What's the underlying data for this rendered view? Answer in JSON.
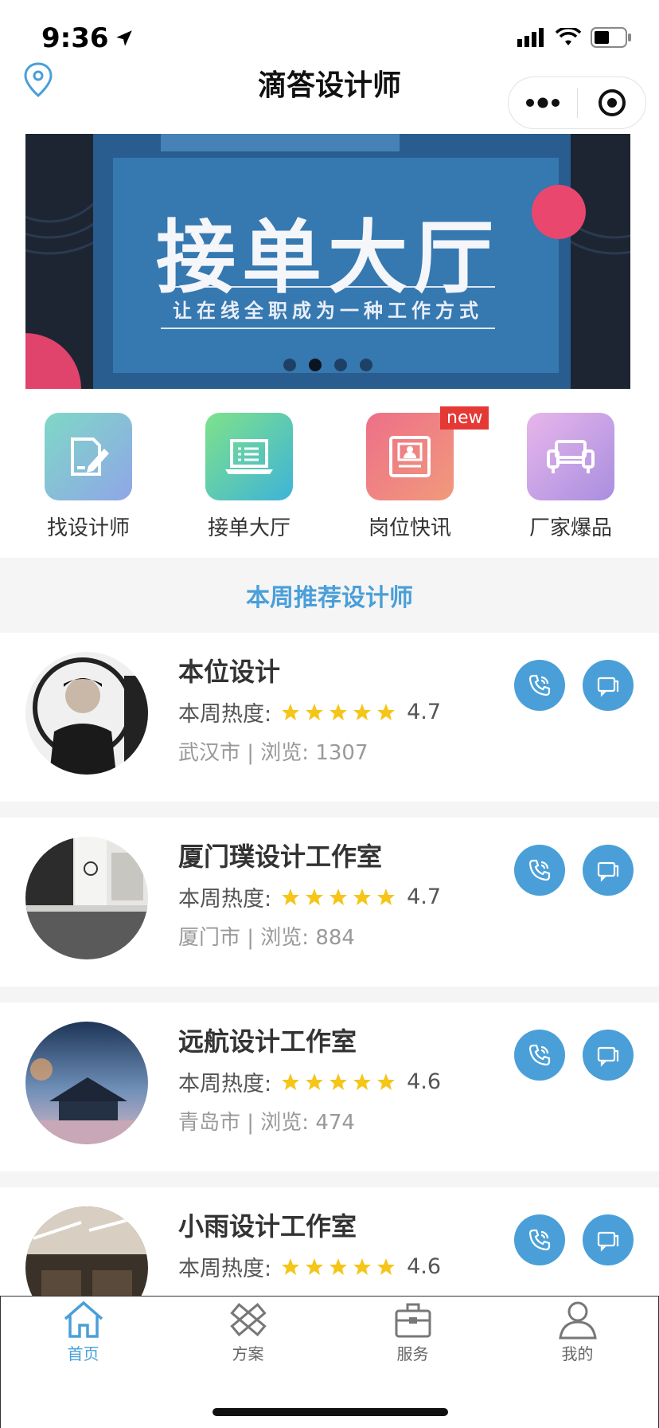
{
  "status_bar": {
    "time": "9:36"
  },
  "nav": {
    "title": "滴答设计师"
  },
  "banner": {
    "title": "接单大厅",
    "subtitle": "让在线全职成为一种工作方式",
    "slide_count": 4,
    "active_slide": 1
  },
  "quick_entries": [
    {
      "label": "找设计师",
      "icon": "edit-document-icon"
    },
    {
      "label": "接单大厅",
      "icon": "laptop-icon"
    },
    {
      "label": "岗位快讯",
      "icon": "id-card-icon",
      "badge": "new"
    },
    {
      "label": "厂家爆品",
      "icon": "sofa-icon"
    }
  ],
  "section": {
    "title": "本周推荐设计师"
  },
  "designers": [
    {
      "name": "本位设计",
      "heat_label": "本周热度:",
      "rating": 4.7,
      "stars": 5,
      "score": "4.7",
      "meta": "武汉市 | 浏览: 1307"
    },
    {
      "name": "厦门璞设计工作室",
      "heat_label": "本周热度:",
      "rating": 4.7,
      "stars": 5,
      "score": "4.7",
      "meta": "厦门市 | 浏览: 884"
    },
    {
      "name": "远航设计工作室",
      "heat_label": "本周热度:",
      "rating": 4.6,
      "stars": 5,
      "score": "4.6",
      "meta": "青岛市 | 浏览: 474"
    },
    {
      "name": "小雨设计工作室",
      "heat_label": "本周热度:",
      "rating": 4.6,
      "stars": 5,
      "score": "4.6",
      "meta": ""
    }
  ],
  "tabbar": {
    "tabs": [
      {
        "label": "首页",
        "icon": "home-icon",
        "active": true
      },
      {
        "label": "方案",
        "icon": "ruler-pencil-icon",
        "active": false
      },
      {
        "label": "服务",
        "icon": "toolbox-icon",
        "active": false
      },
      {
        "label": "我的",
        "icon": "user-icon",
        "active": false
      }
    ]
  },
  "colors": {
    "accent": "#4a9fd8",
    "star": "#f5c518",
    "badge": "#e53935"
  }
}
